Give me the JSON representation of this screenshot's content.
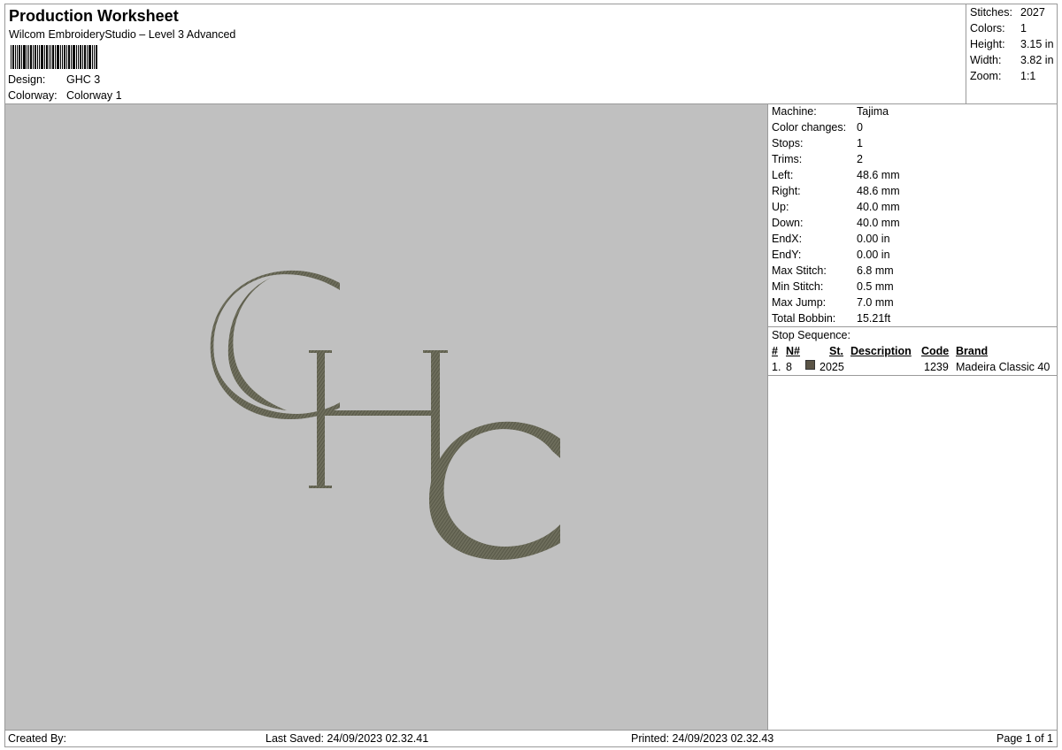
{
  "header": {
    "title": "Production Worksheet",
    "subtitle": "Wilcom EmbroideryStudio – Level 3 Advanced",
    "design_label": "Design:",
    "design_value": "GHC 3",
    "colorway_label": "Colorway:",
    "colorway_value": "Colorway 1"
  },
  "summary": {
    "stitches_label": "Stitches:",
    "stitches_value": "2027",
    "colors_label": "Colors:",
    "colors_value": "1",
    "height_label": "Height:",
    "height_value": "3.15 in",
    "width_label": "Width:",
    "width_value": "3.82 in",
    "zoom_label": "Zoom:",
    "zoom_value": "1:1"
  },
  "design": {
    "text": "GHC",
    "thread_color": "#6e6e5c",
    "canvas_color": "#c0c0c0"
  },
  "info": {
    "rows": [
      {
        "label": "Machine:",
        "value": "Tajima"
      },
      {
        "label": "Color changes:",
        "value": "0"
      },
      {
        "label": "Stops:",
        "value": "1"
      },
      {
        "label": "Trims:",
        "value": "2"
      },
      {
        "label": "Left:",
        "value": "48.6 mm"
      },
      {
        "label": "Right:",
        "value": "48.6 mm"
      },
      {
        "label": "Up:",
        "value": "40.0 mm"
      },
      {
        "label": "Down:",
        "value": "40.0 mm"
      },
      {
        "label": "EndX:",
        "value": "0.00 in"
      },
      {
        "label": "EndY:",
        "value": "0.00 in"
      },
      {
        "label": "Max Stitch:",
        "value": "6.8 mm"
      },
      {
        "label": "Min Stitch:",
        "value": "0.5 mm"
      },
      {
        "label": "Max Jump:",
        "value": "7.0 mm"
      },
      {
        "label": "Total Bobbin:",
        "value": "15.21ft"
      }
    ],
    "stop_sequence_label": "Stop Sequence:",
    "columns": {
      "num": "#",
      "n": "N#",
      "st": "St.",
      "description": "Description",
      "code": "Code",
      "brand": "Brand"
    },
    "stops": [
      {
        "num": "1.",
        "n": "8",
        "color": "#5a5446",
        "st": "2025",
        "description": "",
        "code": "1239",
        "brand": "Madeira Classic 40"
      }
    ]
  },
  "footer": {
    "created_by": "Created By:",
    "last_saved": "Last Saved: 24/09/2023 02.32.41",
    "printed": "Printed: 24/09/2023 02.32.43",
    "page": "Page 1 of 1"
  }
}
